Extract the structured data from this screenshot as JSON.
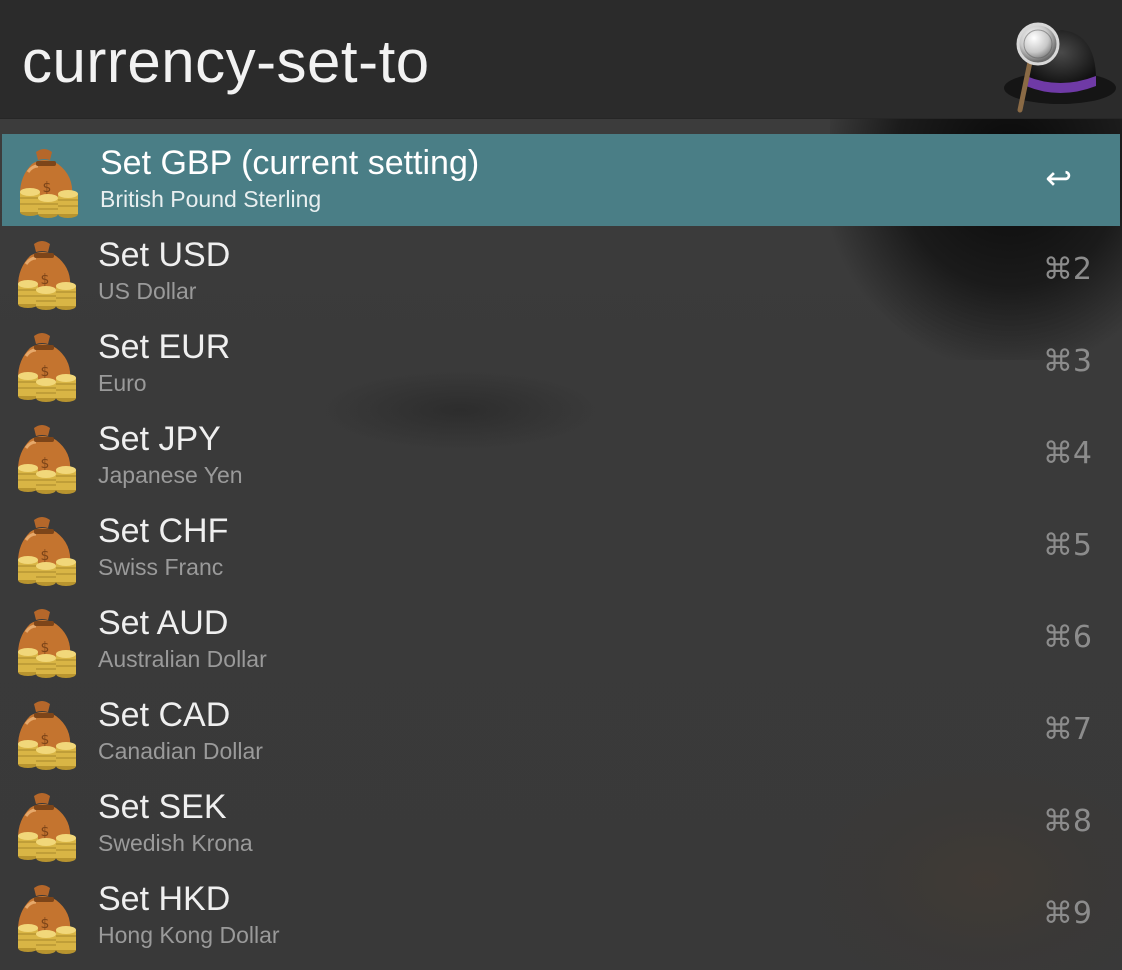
{
  "search": {
    "query": "currency-set-to"
  },
  "app": {
    "logo_icon": "alfred-hat-icon"
  },
  "results": [
    {
      "title": "Set GBP (current setting)",
      "subtitle": "British Pound Sterling",
      "shortcut": "↩",
      "selected": true,
      "icon": "money-bag-icon"
    },
    {
      "title": "Set USD",
      "subtitle": "US Dollar",
      "shortcut": "⌘2",
      "selected": false,
      "icon": "money-bag-icon"
    },
    {
      "title": "Set EUR",
      "subtitle": "Euro",
      "shortcut": "⌘3",
      "selected": false,
      "icon": "money-bag-icon"
    },
    {
      "title": "Set JPY",
      "subtitle": "Japanese Yen",
      "shortcut": "⌘4",
      "selected": false,
      "icon": "money-bag-icon"
    },
    {
      "title": "Set CHF",
      "subtitle": "Swiss Franc",
      "shortcut": "⌘5",
      "selected": false,
      "icon": "money-bag-icon"
    },
    {
      "title": "Set AUD",
      "subtitle": "Australian Dollar",
      "shortcut": "⌘6",
      "selected": false,
      "icon": "money-bag-icon"
    },
    {
      "title": "Set CAD",
      "subtitle": "Canadian Dollar",
      "shortcut": "⌘7",
      "selected": false,
      "icon": "money-bag-icon"
    },
    {
      "title": "Set SEK",
      "subtitle": "Swedish Krona",
      "shortcut": "⌘8",
      "selected": false,
      "icon": "money-bag-icon"
    },
    {
      "title": "Set HKD",
      "subtitle": "Hong Kong Dollar",
      "shortcut": "⌘9",
      "selected": false,
      "icon": "money-bag-icon"
    }
  ],
  "colors": {
    "selection": "#4a7e86",
    "background": "#3a3a3a",
    "search_bar": "#2b2b2b"
  }
}
